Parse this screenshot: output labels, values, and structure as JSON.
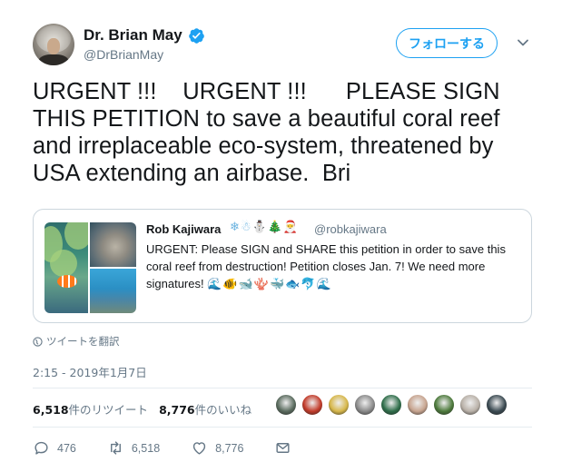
{
  "author": {
    "display_name": "Dr. Brian May",
    "handle": "@DrBrianMay",
    "verified_icon": "verified-badge-icon",
    "avatar": "avatar"
  },
  "header": {
    "follow_label": "フォローする",
    "menu_icon": "chevron-down-icon"
  },
  "tweet": {
    "text": "URGENT !!!    URGENT !!!      PLEASE SIGN\nTHIS PETITION to save a beautiful coral reef\nand irreplaceable eco-system, threatened by\nUSA extending an airbase.  Bri"
  },
  "quote": {
    "name": "Rob Kajiwara",
    "name_emojis": "❄☃⛄🎄🎅",
    "handle": "@robkajiwara",
    "text": "URGENT: Please SIGN and SHARE this petition in order to save this coral reef from destruction! Petition closes Jan. 7! We need more signatures! ",
    "text_emojis": "🌊🐠🐋🪸🐳🐟🐬🌊",
    "images": [
      "clownfish-anemone-image",
      "dugong-image",
      "coral-reef-image"
    ]
  },
  "translate_label": "ツイートを翻訳",
  "timestamp": "2:15 - 2019年1月7日",
  "stats": {
    "retweets_count": "6,518",
    "retweets_label": "件のリツイート",
    "likes_count": "8,776",
    "likes_label": "件のいいね"
  },
  "likers": [
    "#5a6b5e",
    "#c23b2a",
    "#d7b74a",
    "#8a8a8a",
    "#2f6e4a",
    "#c7a48f",
    "#4d7a3c",
    "#b9b1a8",
    "#3b4a52"
  ],
  "actions": {
    "reply_count": "476",
    "retweet_count": "6,518",
    "like_count": "8,776"
  },
  "colors": {
    "accent": "#1da1f2",
    "secondary_text": "#657786",
    "divider": "#e6ecf0"
  }
}
